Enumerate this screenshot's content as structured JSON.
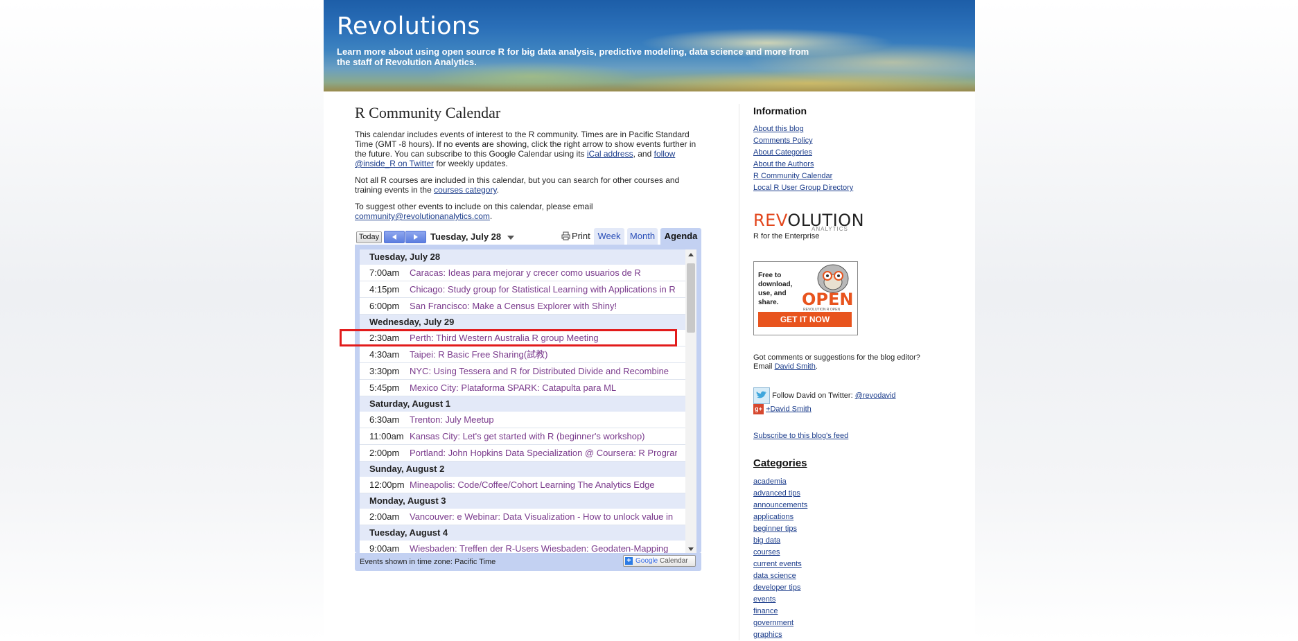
{
  "banner": {
    "title": "Revolutions",
    "tagline": "Learn more about using open source R for big data analysis, predictive modeling, data science and more from the staff of Revolution Analytics."
  },
  "post": {
    "title": "R Community Calendar",
    "p1_a": "This calendar includes events of interest to the R community. Times are in Pacific Standard Time (GMT -8 hours). If no events are showing, click the right arrow to show events further in the future. You can subscribe to this Google Calendar using its ",
    "p1_link1": "iCal address",
    "p1_b": ", and ",
    "p1_link2": "follow @inside_R on Twitter",
    "p1_c": " for weekly updates.",
    "p2_a": "Not all R courses are included in this calendar, but you can search for other courses and training events in the ",
    "p2_link": "courses category",
    "p2_b": ".",
    "p3_a": "To suggest other events to include on this calendar, please email ",
    "p3_link": "community@revolutionanalytics.com",
    "p3_b": "."
  },
  "calendar": {
    "today_label": "Today",
    "date_label": "Tuesday, July 28",
    "print_label": "Print",
    "tabs": {
      "week": "Week",
      "month": "Month",
      "agenda": "Agenda"
    },
    "tz_note": "Events shown in time zone: Pacific Time",
    "gcal_google": "Google",
    "gcal_label": "Calendar",
    "days": [
      {
        "header": "Tuesday, July 28",
        "events": [
          {
            "time": "7:00am",
            "title": "Caracas: Ideas para mejorar y crecer como usuarios de R"
          },
          {
            "time": "4:15pm",
            "title": "Chicago: Study group for Statistical Learning with Applications in R"
          },
          {
            "time": "6:00pm",
            "title": "San Francisco: Make a Census Explorer with Shiny!"
          }
        ]
      },
      {
        "header": "Wednesday, July 29",
        "events": [
          {
            "time": "2:30am",
            "title": "Perth: Third Western Australia R group Meeting"
          },
          {
            "time": "4:30am",
            "title": "Taipei: R Basic Free Sharing(試教)"
          },
          {
            "time": "3:30pm",
            "title": "NYC: Using Tessera and R for Distributed Divide and Recombine"
          },
          {
            "time": "5:45pm",
            "title": "Mexico City: Plataforma SPARK: Catapulta para ML"
          }
        ]
      },
      {
        "header": "Saturday, August 1",
        "events": [
          {
            "time": "6:30am",
            "title": "Trenton: July Meetup"
          },
          {
            "time": "11:00am",
            "title": "Kansas City: Let's get started with R (beginner's workshop)"
          },
          {
            "time": "2:00pm",
            "title": "Portland: John Hopkins Data Specialization @ Coursera: R Programming"
          }
        ]
      },
      {
        "header": "Sunday, August 2",
        "events": [
          {
            "time": "12:00pm",
            "title": "Mineapolis: Code/Coffee/Cohort Learning The Analytics Edge"
          }
        ]
      },
      {
        "header": "Monday, August 3",
        "events": [
          {
            "time": "2:00am",
            "title": "Vancouver: e Webinar: Data Visualization - How to unlock value in"
          }
        ]
      },
      {
        "header": "Tuesday, August 4",
        "events": [
          {
            "time": "9:00am",
            "title": "Wiesbaden: Treffen der R-Users Wiesbaden: Geodaten-Mapping"
          }
        ]
      }
    ]
  },
  "sidebar": {
    "info_heading": "Information",
    "info_links": [
      "About this blog",
      "Comments Policy",
      "About Categories",
      "About the Authors",
      "R Community Calendar",
      "Local R User Group Directory"
    ],
    "logo_rev": "REV",
    "logo_olution": "OLUTION",
    "logo_sub": "ANALYTICS",
    "logo_tagline": "R for the Enterprise",
    "ad_free": "Free to download, use, and share.",
    "ad_open": "OPEN",
    "ad_open_sub": "REVOLUTION R OPEN",
    "ad_cta": "GET IT NOW",
    "comments_a": "Got comments or suggestions for the blog editor?",
    "comments_b": "Email ",
    "comments_link": "David Smith",
    "comments_c": ".",
    "twitter_text": "Follow David on Twitter: ",
    "twitter_link": "@revodavid",
    "gplus_link": "+David Smith",
    "feed_link": "Subscribe to this blog's feed",
    "categories_heading": "Categories",
    "categories": [
      "academia",
      "advanced tips",
      "announcements",
      "applications",
      "beginner tips",
      "big data",
      "courses",
      "current events",
      "data science",
      "developer tips",
      "events",
      "finance",
      "government",
      "graphics"
    ]
  },
  "colors": {
    "highlight": "#e21b1b",
    "link": "#1d3e8c",
    "event_title": "#7a3a8c",
    "calendar_frame": "#c3d1f2"
  }
}
